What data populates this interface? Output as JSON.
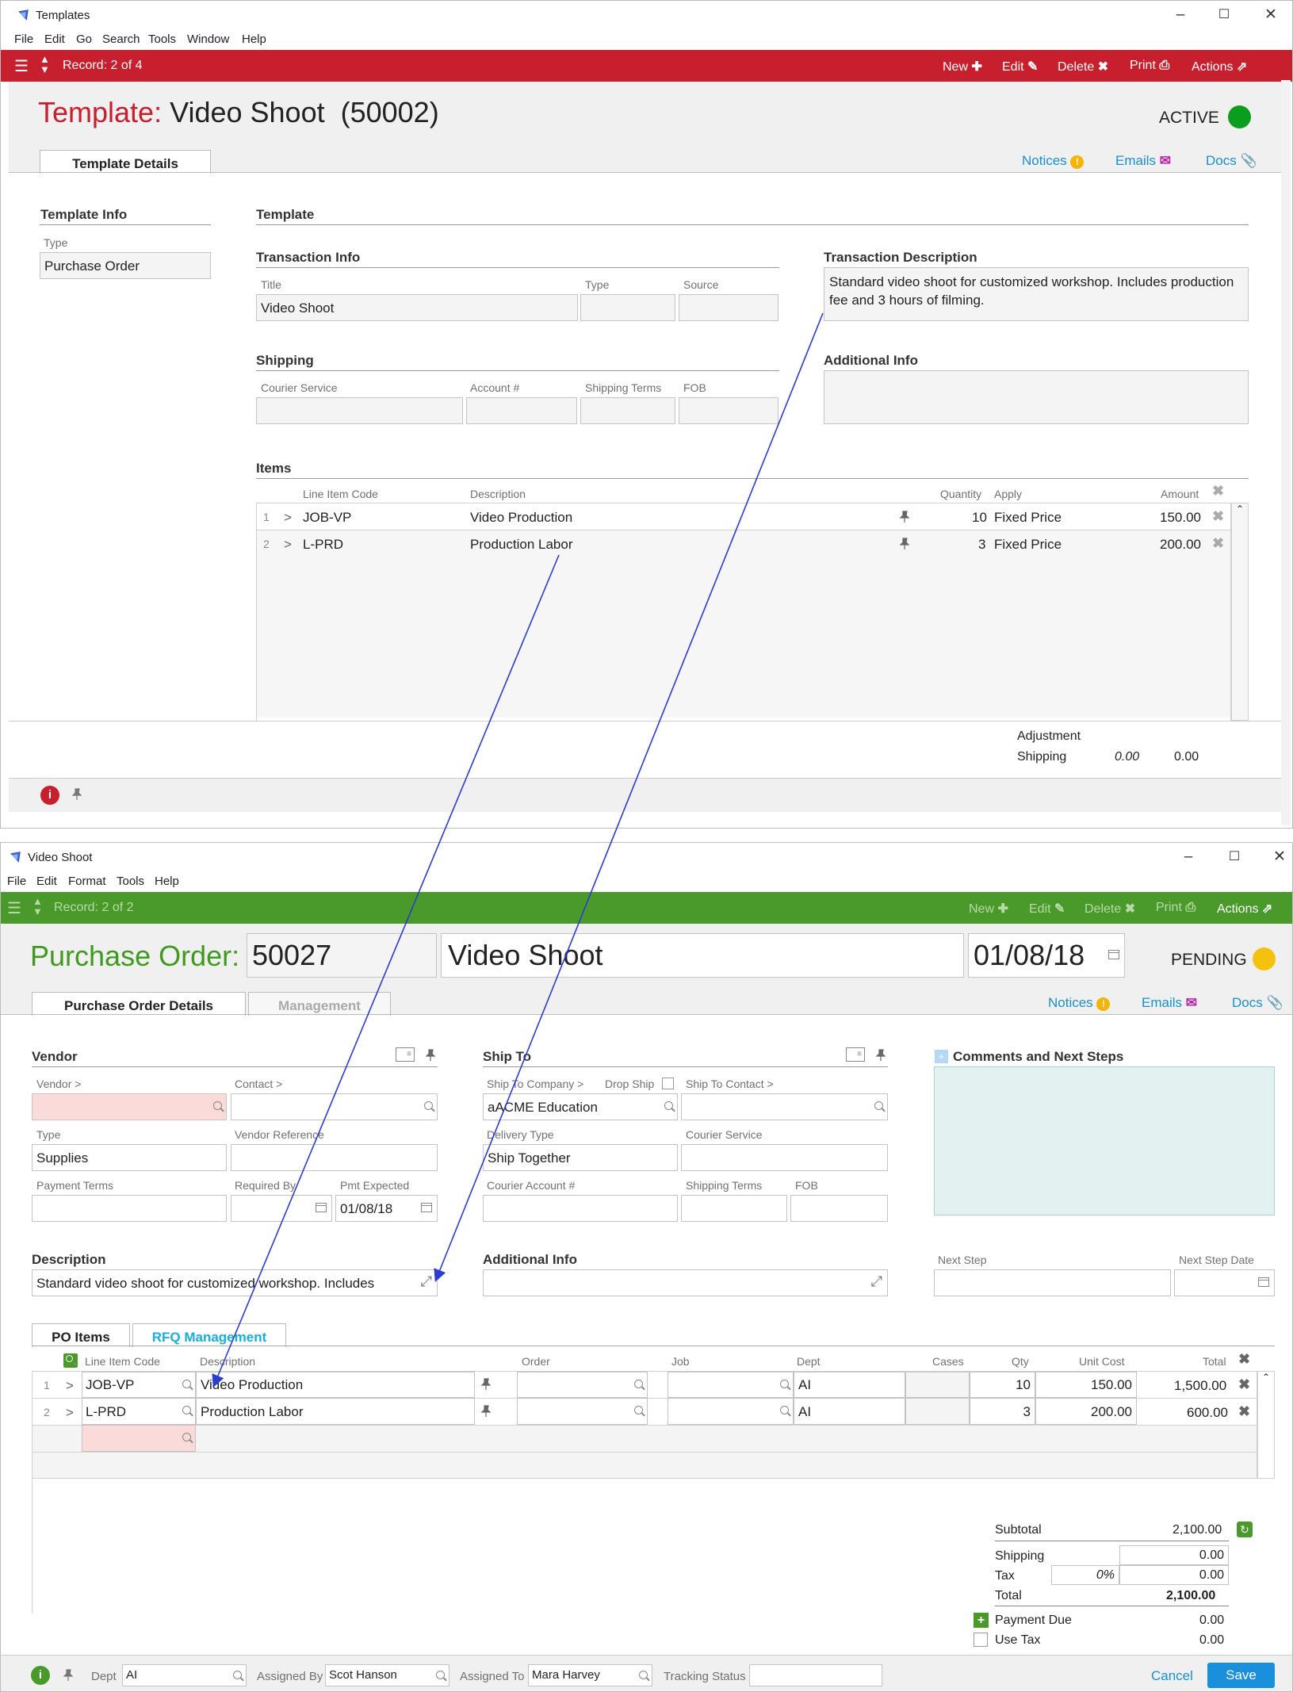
{
  "templates_window": {
    "title": "Templates",
    "menu": [
      "File",
      "Edit",
      "Go",
      "Search",
      "Tools",
      "Window",
      "Help"
    ],
    "record": "Record: 2 of 4",
    "actions": {
      "new": "New",
      "edit": "Edit",
      "delete": "Delete",
      "print": "Print",
      "actions": "Actions"
    },
    "heading_prefix": "Template:",
    "heading_name": "Video Shoot  (50002)",
    "status": "ACTIVE",
    "status_color": "#0a9e1e",
    "tab": "Template Details",
    "links": {
      "notices": "Notices",
      "emails": "Emails",
      "docs": "Docs"
    },
    "template_info": {
      "heading": "Template Info",
      "type_label": "Type",
      "type_value": "Purchase Order"
    },
    "template_heading": "Template",
    "transaction_info": {
      "heading": "Transaction Info",
      "title_label": "Title",
      "title_value": "Video Shoot",
      "type_label": "Type",
      "source_label": "Source"
    },
    "transaction_description": {
      "heading": "Transaction Description",
      "value": "Standard video shoot for customized workshop. Includes production fee and 3 hours of filming."
    },
    "shipping": {
      "heading": "Shipping",
      "courier_label": "Courier Service",
      "account_label": "Account #",
      "terms_label": "Shipping Terms",
      "fob_label": "FOB"
    },
    "additional_info": {
      "heading": "Additional Info"
    },
    "items": {
      "heading": "Items",
      "columns": {
        "code": "Line Item Code",
        "description": "Description",
        "quantity": "Quantity",
        "apply": "Apply",
        "amount": "Amount"
      },
      "rows": [
        {
          "num": "1",
          "code": "JOB-VP",
          "description": "Video Production",
          "quantity": "10",
          "apply": "Fixed Price",
          "amount": "150.00"
        },
        {
          "num": "2",
          "code": "L-PRD",
          "description": "Production Labor",
          "quantity": "3",
          "apply": "Fixed Price",
          "amount": "200.00"
        }
      ]
    },
    "totals": {
      "adjustment_label": "Adjustment",
      "shipping_label": "Shipping",
      "shipping_italic": "0.00",
      "shipping_value": "0.00"
    }
  },
  "po_window": {
    "title": "Video Shoot",
    "menu": [
      "File",
      "Edit",
      "Format",
      "Tools",
      "Help"
    ],
    "record": "Record: 2 of 2",
    "actions": {
      "new": "New",
      "edit": "Edit",
      "delete": "Delete",
      "print": "Print",
      "actions": "Actions"
    },
    "heading_prefix": "Purchase Order:",
    "number": "50027",
    "date": "01/08/18",
    "status": "PENDING",
    "status_color": "#f4c20d",
    "tabs": {
      "details": "Purchase Order Details",
      "management": "Management"
    },
    "links": {
      "notices": "Notices",
      "emails": "Emails",
      "docs": "Docs"
    },
    "vendor": {
      "heading": "Vendor",
      "vendor_label": "Vendor >",
      "contact_label": "Contact >",
      "type_label": "Type",
      "type_value": "Supplies",
      "vendor_ref_label": "Vendor Reference",
      "payment_terms_label": "Payment Terms",
      "required_by_label": "Required By",
      "pmt_expected_label": "Pmt Expected",
      "pmt_expected_value": "01/08/18"
    },
    "ship_to": {
      "heading": "Ship To",
      "company_label": "Ship To Company >",
      "drop_ship_label": "Drop Ship",
      "contact_label": "Ship To Contact >",
      "company_value": "aACME Education",
      "delivery_label": "Delivery Type",
      "delivery_value": "Ship Together",
      "courier_label": "Courier Service",
      "courier_account_label": "Courier Account #",
      "terms_label": "Shipping Terms",
      "fob_label": "FOB"
    },
    "comments": {
      "heading": "Comments and Next Steps",
      "next_step_label": "Next Step",
      "next_step_date_label": "Next Step Date"
    },
    "description": {
      "heading": "Description",
      "value": "Standard video shoot for customized workshop. Includes"
    },
    "additional_info": {
      "heading": "Additional Info"
    },
    "item_tabs": {
      "po_items": "PO Items",
      "rfq": "RFQ Management"
    },
    "items": {
      "columns": {
        "code": "Line Item Code",
        "description": "Description",
        "order": "Order",
        "job": "Job",
        "dept": "Dept",
        "cases": "Cases",
        "qty": "Qty",
        "unit_cost": "Unit Cost",
        "total": "Total"
      },
      "rows": [
        {
          "num": "1",
          "code": "JOB-VP",
          "description": "Video Production",
          "dept": "AI",
          "qty": "10",
          "unit_cost": "150.00",
          "total": "1,500.00"
        },
        {
          "num": "2",
          "code": "L-PRD",
          "description": "Production Labor",
          "dept": "AI",
          "qty": "3",
          "unit_cost": "200.00",
          "total": "600.00"
        }
      ]
    },
    "totals": {
      "subtotal_label": "Subtotal",
      "subtotal": "2,100.00",
      "shipping_label": "Shipping",
      "shipping": "0.00",
      "tax_label": "Tax",
      "tax_rate": "0%",
      "tax": "0.00",
      "total_label": "Total",
      "total": "2,100.00",
      "payment_due_label": "Payment Due",
      "payment_due": "0.00",
      "use_tax_label": "Use Tax",
      "use_tax": "0.00"
    },
    "footer": {
      "dept_label": "Dept",
      "dept_value": "AI",
      "assigned_by_label": "Assigned By",
      "assigned_by_value": "Scot Hanson",
      "assigned_to_label": "Assigned To",
      "assigned_to_value": "Mara Harvey",
      "tracking_label": "Tracking Status",
      "cancel": "Cancel",
      "save": "Save"
    }
  },
  "colors": {
    "template_red": "#c71f2d",
    "po_green": "#4a9a2b",
    "link_blue": "#1a8fcf",
    "save_blue": "#1a8fdc"
  }
}
